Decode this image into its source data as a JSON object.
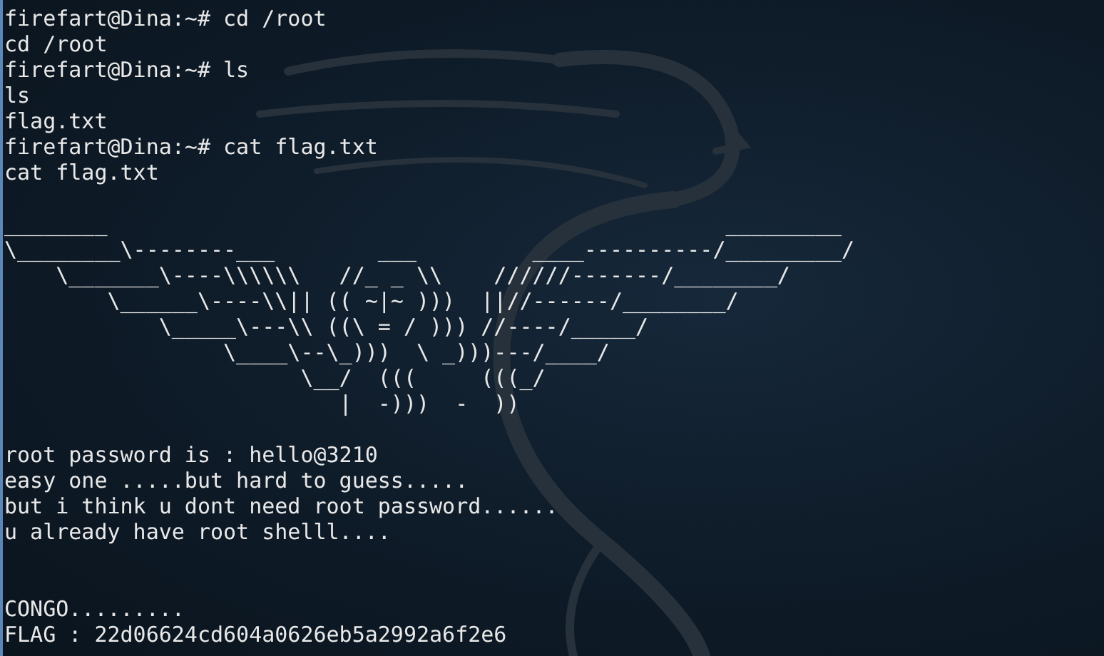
{
  "terminal": {
    "lines": [
      {
        "kind": "text",
        "text": "firefart@Dina:~# cd /root"
      },
      {
        "kind": "text",
        "text": "cd /root"
      },
      {
        "kind": "text",
        "text": "firefart@Dina:~# ls"
      },
      {
        "kind": "text",
        "text": "ls"
      },
      {
        "kind": "text",
        "text": "flag.txt"
      },
      {
        "kind": "text",
        "text": "firefart@Dina:~# cat flag.txt"
      },
      {
        "kind": "text",
        "text": "cat flag.txt"
      },
      {
        "kind": "blank"
      },
      {
        "kind": "text",
        "text": "________                                                _________"
      },
      {
        "kind": "text",
        "text": "\\________\\--------___        ___         ____----------/_________/"
      },
      {
        "kind": "text",
        "text": "    \\_______\\----\\\\\\\\\\\\   //_ _ \\\\    //////-------/________/"
      },
      {
        "kind": "text",
        "text": "        \\______\\----\\\\|| (( ~|~ )))  ||//------/________/"
      },
      {
        "kind": "text",
        "text": "            \\_____\\---\\\\ ((\\ = / ))) //----/_____/"
      },
      {
        "kind": "text",
        "text": "                 \\____\\--\\_)))  \\ _)))---/____/"
      },
      {
        "kind": "text",
        "text": "                       \\__/  (((     (((_/"
      },
      {
        "kind": "text",
        "text": "                          |  -)))  -  ))"
      },
      {
        "kind": "blank"
      },
      {
        "kind": "text",
        "text": "root password is : hello@3210"
      },
      {
        "kind": "text",
        "text": "easy one .....but hard to guess....."
      },
      {
        "kind": "text",
        "text": "but i think u dont need root password......"
      },
      {
        "kind": "text",
        "text": "u already have root shelll...."
      },
      {
        "kind": "blank"
      },
      {
        "kind": "blank"
      },
      {
        "kind": "text",
        "text": "CONGO........."
      },
      {
        "kind": "text",
        "text": "FLAG : 22d06624cd604a0626eb5a2992a6f2e6"
      }
    ]
  }
}
